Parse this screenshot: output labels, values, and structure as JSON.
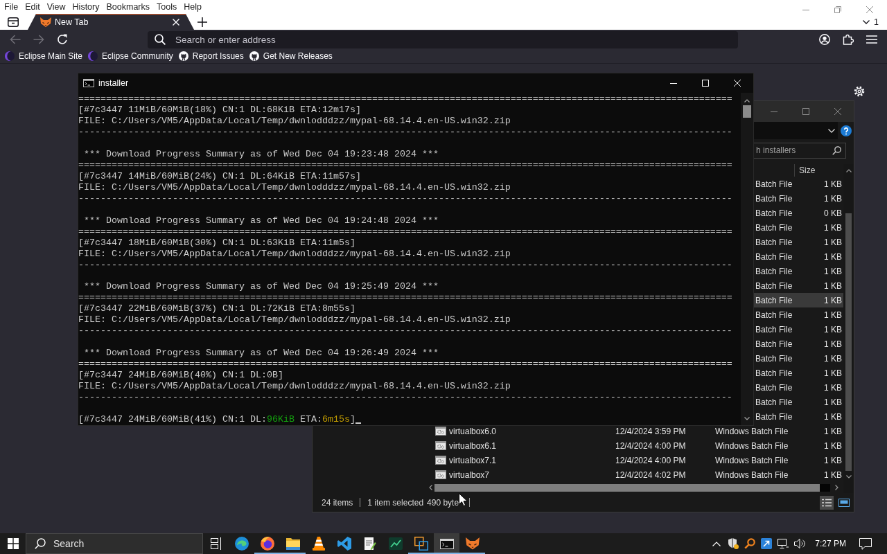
{
  "browser": {
    "menu": [
      "File",
      "Edit",
      "View",
      "History",
      "Bookmarks",
      "Tools",
      "Help"
    ],
    "tabs": [
      {
        "title": "New Tab",
        "selected": true
      }
    ],
    "tab_count": "1",
    "back": {
      "disabled": true
    },
    "forward": {
      "disabled": true
    },
    "address_bar": {
      "placeholder": "Search or enter address"
    },
    "bookmarks": [
      {
        "label": "Eclipse Main Site",
        "kind": "crescent"
      },
      {
        "label": "Eclipse Community",
        "kind": "crescent"
      },
      {
        "label": "Report Issues",
        "kind": "cat"
      },
      {
        "label": "Get New Releases",
        "kind": "cat"
      }
    ]
  },
  "console_window": {
    "title": "installer",
    "lines": [
      {
        "kind": "text",
        "text": "======================================================================================================================"
      },
      {
        "kind": "text",
        "text": "[#7c3447 11MiB/60MiB(18%) CN:1 DL:68KiB ETA:12m17s]"
      },
      {
        "kind": "text",
        "text": "FILE: C:/Users/VM5/AppData/Local/Temp/dwnlodddzz/mypal-68.14.4.en-US.win32.zip"
      },
      {
        "kind": "text",
        "text": "----------------------------------------------------------------------------------------------------------------------"
      },
      {
        "kind": "blank"
      },
      {
        "kind": "text",
        "text": " *** Download Progress Summary as of Wed Dec 04 19:23:48 2024 ***"
      },
      {
        "kind": "text",
        "text": "======================================================================================================================"
      },
      {
        "kind": "text",
        "text": "[#7c3447 14MiB/60MiB(24%) CN:1 DL:64KiB ETA:11m57s]"
      },
      {
        "kind": "text",
        "text": "FILE: C:/Users/VM5/AppData/Local/Temp/dwnlodddzz/mypal-68.14.4.en-US.win32.zip"
      },
      {
        "kind": "text",
        "text": "----------------------------------------------------------------------------------------------------------------------"
      },
      {
        "kind": "blank"
      },
      {
        "kind": "text",
        "text": " *** Download Progress Summary as of Wed Dec 04 19:24:48 2024 ***"
      },
      {
        "kind": "text",
        "text": "======================================================================================================================"
      },
      {
        "kind": "text",
        "text": "[#7c3447 18MiB/60MiB(30%) CN:1 DL:63KiB ETA:11m5s]"
      },
      {
        "kind": "text",
        "text": "FILE: C:/Users/VM5/AppData/Local/Temp/dwnlodddzz/mypal-68.14.4.en-US.win32.zip"
      },
      {
        "kind": "text",
        "text": "----------------------------------------------------------------------------------------------------------------------"
      },
      {
        "kind": "blank"
      },
      {
        "kind": "text",
        "text": " *** Download Progress Summary as of Wed Dec 04 19:25:49 2024 ***"
      },
      {
        "kind": "text",
        "text": "======================================================================================================================"
      },
      {
        "kind": "text",
        "text": "[#7c3447 22MiB/60MiB(37%) CN:1 DL:72KiB ETA:8m55s]"
      },
      {
        "kind": "text",
        "text": "FILE: C:/Users/VM5/AppData/Local/Temp/dwnlodddzz/mypal-68.14.4.en-US.win32.zip"
      },
      {
        "kind": "text",
        "text": "----------------------------------------------------------------------------------------------------------------------"
      },
      {
        "kind": "blank"
      },
      {
        "kind": "text",
        "text": " *** Download Progress Summary as of Wed Dec 04 19:26:49 2024 ***"
      },
      {
        "kind": "text",
        "text": "======================================================================================================================"
      },
      {
        "kind": "text",
        "text": "[#7c3447 24MiB/60MiB(40%) CN:1 DL:0B]"
      },
      {
        "kind": "text",
        "text": "FILE: C:/Users/VM5/AppData/Local/Temp/dwnlodddzz/mypal-68.14.4.en-US.win32.zip"
      },
      {
        "kind": "text",
        "text": "----------------------------------------------------------------------------------------------------------------------"
      },
      {
        "kind": "blank"
      },
      {
        "kind": "segments",
        "cursor": true,
        "segments": [
          {
            "kind": "plain",
            "text": "[#7c3447 24MiB/60MiB(41%) CN:1 DL:"
          },
          {
            "kind": "speed",
            "text": "96KiB"
          },
          {
            "kind": "plain",
            "text": " ETA:"
          },
          {
            "kind": "time",
            "text": "6m15s"
          },
          {
            "kind": "plain",
            "text": "]"
          }
        ]
      }
    ]
  },
  "explorer_window": {
    "search": {
      "placeholder": "h installers"
    },
    "columns": [
      "Size"
    ],
    "rows": [
      {
        "kind": "partial",
        "type": "Batch File",
        "size": "1 KB",
        "selected": false
      },
      {
        "kind": "partial",
        "type": "Batch File",
        "size": "1 KB",
        "selected": false
      },
      {
        "kind": "partial",
        "type": "Batch File",
        "size": "0 KB",
        "selected": false
      },
      {
        "kind": "partial",
        "type": "Batch File",
        "size": "1 KB",
        "selected": false
      },
      {
        "kind": "partial",
        "type": "Batch File",
        "size": "1 KB",
        "selected": false
      },
      {
        "kind": "partial",
        "type": "Batch File",
        "size": "1 KB",
        "selected": false
      },
      {
        "kind": "partial",
        "type": "Batch File",
        "size": "1 KB",
        "selected": false
      },
      {
        "kind": "partial",
        "type": "Batch File",
        "size": "1 KB",
        "selected": false
      },
      {
        "kind": "partial",
        "type": "Batch File",
        "size": "1 KB",
        "selected": true
      },
      {
        "kind": "partial",
        "type": "Batch File",
        "size": "1 KB",
        "selected": false
      },
      {
        "kind": "partial",
        "type": "Batch File",
        "size": "1 KB",
        "selected": false
      },
      {
        "kind": "partial",
        "type": "Batch File",
        "size": "1 KB",
        "selected": false
      },
      {
        "kind": "partial",
        "type": "Batch File",
        "size": "1 KB",
        "selected": false
      },
      {
        "kind": "partial",
        "type": "Batch File",
        "size": "1 KB",
        "selected": false
      },
      {
        "kind": "partial",
        "type": "Batch File",
        "size": "1 KB",
        "selected": false
      },
      {
        "kind": "partial",
        "type": "Batch File",
        "size": "1 KB",
        "selected": false
      },
      {
        "kind": "partial",
        "type": "Batch File",
        "size": "1 KB",
        "selected": false
      },
      {
        "kind": "full",
        "name": "virtualbox6.0",
        "date": "12/4/2024 3:59 PM",
        "type": "Windows Batch File",
        "size": "1 KB",
        "selected": false
      },
      {
        "kind": "full",
        "name": "virtualbox6.1",
        "date": "12/4/2024 4:00 PM",
        "type": "Windows Batch File",
        "size": "1 KB",
        "selected": false
      },
      {
        "kind": "full",
        "name": "virtualbox7.1",
        "date": "12/4/2024 4:00 PM",
        "type": "Windows Batch File",
        "size": "1 KB",
        "selected": false
      },
      {
        "kind": "full",
        "name": "virtualbox7",
        "date": "12/4/2024 4:02 PM",
        "type": "Windows Batch File",
        "size": "1 KB",
        "selected": false
      }
    ],
    "status_bar": {
      "item_count": "24 items",
      "selection": "1 item selected",
      "selection_size": "490 byte"
    },
    "view_buttons": [
      {
        "kind": "details",
        "selected": true
      },
      {
        "kind": "tiles",
        "selected": false
      }
    ]
  },
  "taskbar": {
    "search": {
      "placeholder": "Search"
    },
    "apps": [
      {
        "kind": "task-view",
        "running": false,
        "active": false
      },
      {
        "kind": "swirl",
        "running": false,
        "active": false
      },
      {
        "kind": "globe",
        "running": true,
        "active": false
      },
      {
        "kind": "folder",
        "running": true,
        "active": false
      },
      {
        "kind": "cone",
        "running": false,
        "active": false
      },
      {
        "kind": "ribbon",
        "running": false,
        "active": false
      },
      {
        "kind": "notepad",
        "running": false,
        "active": false
      },
      {
        "kind": "chart",
        "running": false,
        "active": false
      },
      {
        "kind": "squares",
        "running": true,
        "active": false
      },
      {
        "kind": "terminal",
        "running": true,
        "active": true
      },
      {
        "kind": "fox",
        "running": true,
        "active": false
      }
    ],
    "clock": "7:27 PM"
  }
}
